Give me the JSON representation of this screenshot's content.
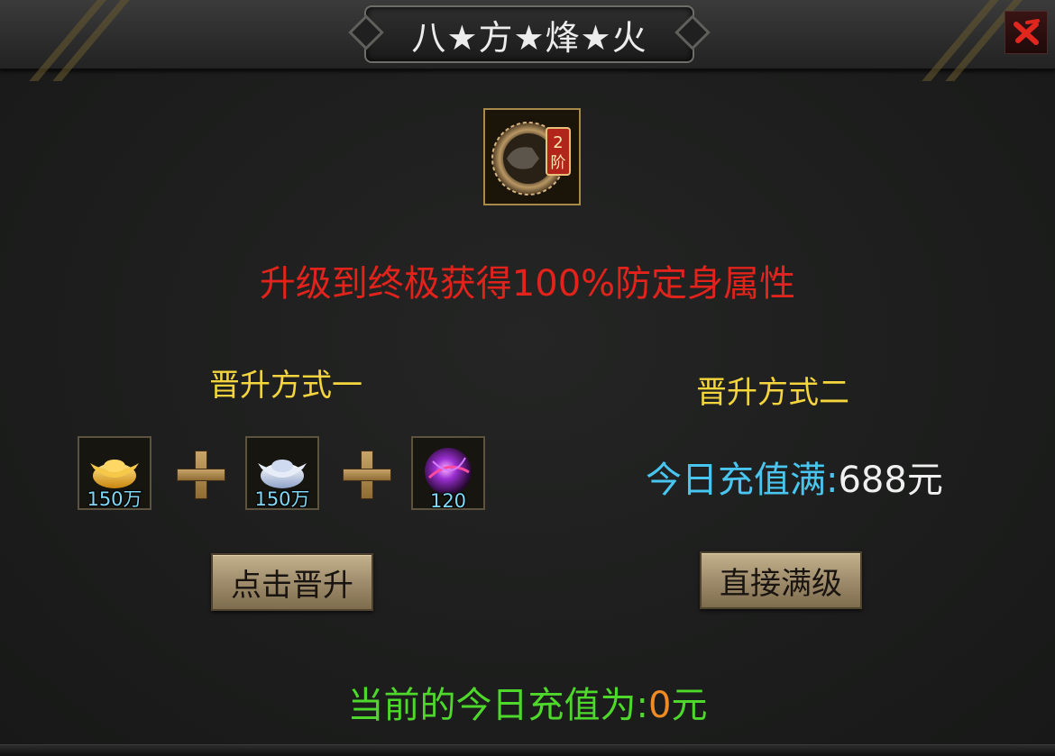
{
  "window": {
    "title": "八★方★烽★火"
  },
  "item": {
    "icon": "upgrade-ring-icon",
    "badge_number": "2",
    "badge_text": "阶"
  },
  "promo_text": "升级到终极获得100%防定身属性",
  "method_one": {
    "label": "晋升方式一",
    "materials": [
      {
        "icon": "gold-ingot-icon",
        "count": "150万"
      },
      {
        "icon": "silver-ingot-icon",
        "count": "150万"
      },
      {
        "icon": "purple-orb-icon",
        "count": "120"
      }
    ],
    "button_label": "点击晋升"
  },
  "method_two": {
    "label": "晋升方式二",
    "requirement_label": "今日充值满:",
    "requirement_value": "688元",
    "button_label": "直接满级"
  },
  "current_recharge": {
    "label": "当前的今日充值为:",
    "value": "0",
    "unit": "元"
  },
  "colors": {
    "promo": "#e1231c",
    "method_label": "#f4d53e",
    "requirement": "#49c6ef",
    "current": "#4fd82c",
    "current_value": "#f08a24"
  }
}
